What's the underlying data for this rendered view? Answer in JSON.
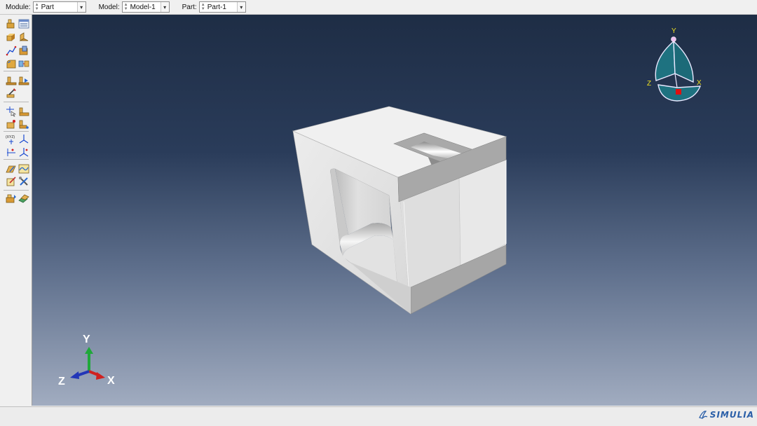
{
  "context_bar": {
    "module": {
      "label": "Module:",
      "value": "Part"
    },
    "model": {
      "label": "Model:",
      "value": "Model-1"
    },
    "part": {
      "label": "Part:",
      "value": "Part-1"
    }
  },
  "view_cube": {
    "y_label": "Y",
    "x_label": "X",
    "z_label": "Z"
  },
  "triad": {
    "y_label": "Y",
    "x_label": "X",
    "z_label": "Z",
    "x_color": "#d02020",
    "y_color": "#1fa83a",
    "z_color": "#2236b8"
  },
  "branding": {
    "text": "SIMULIA",
    "color": "#2a5fa8"
  },
  "colors": {
    "viewport_top": "#1e2d45",
    "viewport_bottom": "#a1acc0",
    "part_face": "#e3e3e3"
  }
}
